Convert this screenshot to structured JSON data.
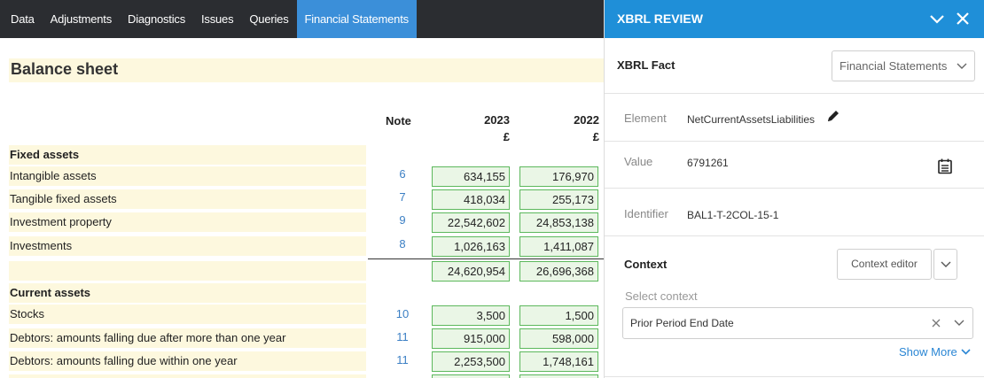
{
  "tabs": [
    "Data",
    "Adjustments",
    "Diagnostics",
    "Issues",
    "Queries",
    "Financial Statements"
  ],
  "active_tab": "Financial Statements",
  "sheet": {
    "title": "Balance sheet",
    "col_note": "Note",
    "col_2023": "2023",
    "col_2022": "2022",
    "currency": "£",
    "rows": [
      {
        "label": "Fixed assets",
        "heading": true
      },
      {
        "label": "Intangible assets",
        "note": "6",
        "v2023": "634,155",
        "v2022": "176,970"
      },
      {
        "label": "Tangible fixed assets",
        "note": "7",
        "v2023": "418,034",
        "v2022": "255,173"
      },
      {
        "label": "Investment property",
        "note": "9",
        "v2023": "22,542,602",
        "v2022": "24,853,138"
      },
      {
        "label": "Investments",
        "note": "8",
        "v2023": "1,026,163",
        "v2022": "1,411,087"
      },
      {
        "label": "",
        "v2023": "24,620,954",
        "v2022": "26,696,368"
      },
      {
        "label": "Current assets",
        "heading": true
      },
      {
        "label": "Stocks",
        "note": "10",
        "v2023": "3,500",
        "v2022": "1,500"
      },
      {
        "label": "Debtors: amounts falling due after more than one year",
        "note": "11",
        "v2023": "915,000",
        "v2022": "598,000"
      },
      {
        "label": "Debtors: amounts falling due within one year",
        "note": "11",
        "v2023": "2,253,500",
        "v2022": "1,748,161"
      }
    ]
  },
  "xbrl": {
    "title": "XBRL REVIEW",
    "fact_label": "XBRL Fact",
    "fact_select": "Financial Statements",
    "element_label": "Element",
    "element_value": "NetCurrentAssetsLiabilities",
    "value_label": "Value",
    "value_value": "6791261",
    "identifier_label": "Identifier",
    "identifier_value": "BAL1-T-2COL-15-1",
    "context_label": "Context",
    "context_editor": "Context editor",
    "select_context_label": "Select context",
    "select_context_value": "Prior Period End Date",
    "show_more": "Show More"
  },
  "colors": {
    "nav_bg": "#2b2d31",
    "active_tab": "#3b8fd9",
    "xbrl_header": "#1f8fd8",
    "row_bg": "#fdf8de",
    "cell_border": "#5cb85c",
    "link": "#2a86d4"
  },
  "icons": {
    "edit": "pencil-icon",
    "calendar": "calendar-icon",
    "collapse": "chevron-down-icon",
    "close": "close-icon",
    "clear": "clear-icon"
  }
}
